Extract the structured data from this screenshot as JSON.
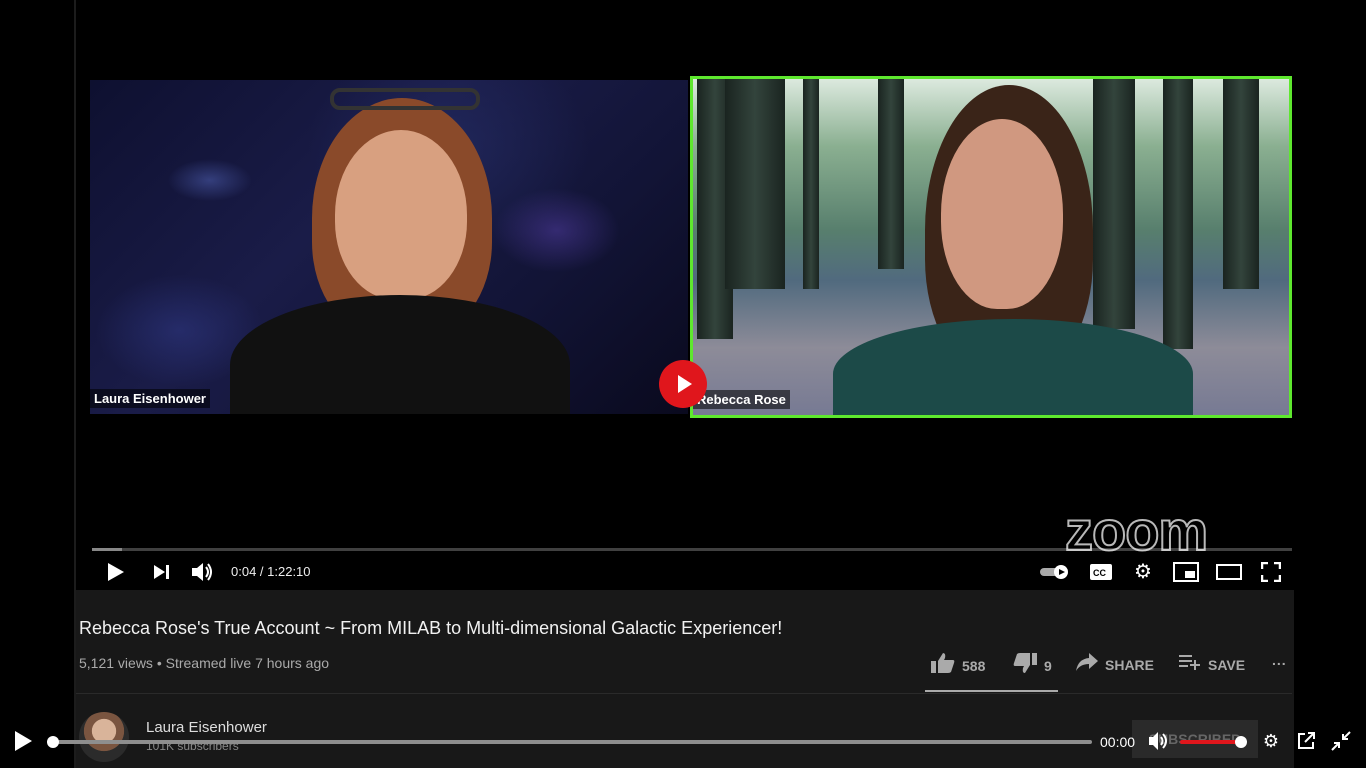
{
  "video": {
    "participants": [
      {
        "name": "Laura Eisenhower"
      },
      {
        "name": "Rebecca Rose"
      }
    ],
    "watermark": "zoom",
    "player": {
      "time": "0:04 / 1:22:10"
    }
  },
  "youtube": {
    "title": "Rebecca Rose's True Account ~ From MILAB to Multi-dimensional Galactic Experiencer!",
    "meta": "5,121 views • Streamed live 7 hours ago",
    "likes": "588",
    "dislikes": "9",
    "share_label": "SHARE",
    "save_label": "SAVE",
    "more_label": "...",
    "channel": {
      "name": "Laura Eisenhower",
      "subscribers": "101K subscribers",
      "subscribe_label": "SUBSCRIBED"
    }
  },
  "outer_player": {
    "current_time": "00:00",
    "seek_progress": 0.0,
    "volume_level": 1.0
  },
  "colors": {
    "active_speaker_border": "#5ee82e",
    "play_red": "#e0161c",
    "volume_red": "#e0161c"
  }
}
